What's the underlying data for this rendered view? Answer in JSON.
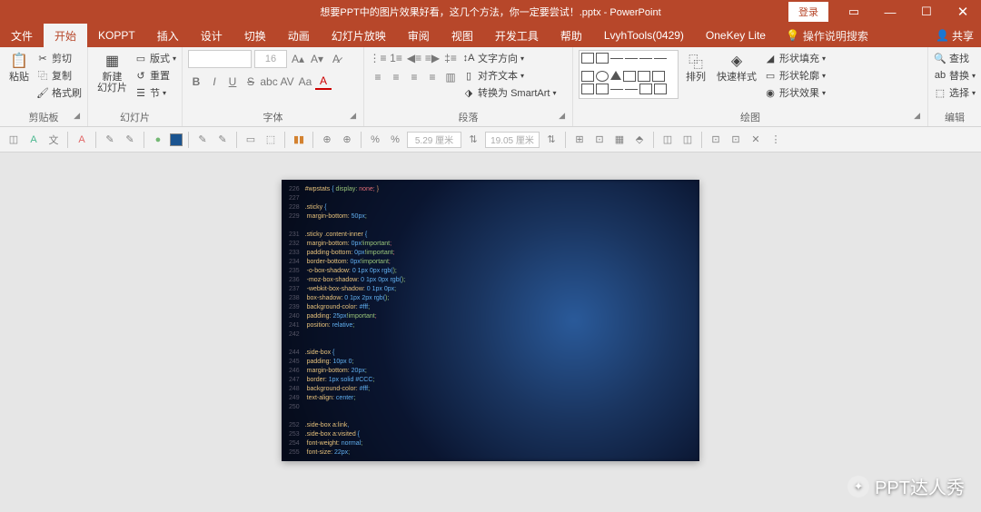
{
  "title": "想要PPT中的图片效果好看，这几个方法，你一定要尝试！.pptx - PowerPoint",
  "login": "登录",
  "menu": {
    "file": "文件",
    "home": "开始",
    "koppt": "KOPPT",
    "insert": "插入",
    "design": "设计",
    "transitions": "切换",
    "animations": "动画",
    "slideshow": "幻灯片放映",
    "review": "审阅",
    "view": "视图",
    "developer": "开发工具",
    "help": "帮助",
    "lvyh": "LvyhTools(0429)",
    "onekey": "OneKey Lite",
    "tellme": "操作说明搜索",
    "share": "共享"
  },
  "ribbon": {
    "clipboard": {
      "label": "剪贴板",
      "paste": "粘贴",
      "cut": "剪切",
      "copy": "复制",
      "painter": "格式刷"
    },
    "slides": {
      "label": "幻灯片",
      "new": "新建\n幻灯片",
      "layout": "版式",
      "reset": "重置",
      "section": "节"
    },
    "font": {
      "label": "字体",
      "size_placeholder": "16"
    },
    "paragraph": {
      "label": "段落",
      "direction": "文字方向",
      "align": "对齐文本",
      "smartart": "转换为 SmartArt"
    },
    "drawing": {
      "label": "绘图",
      "arrange": "排列",
      "quickstyles": "快速样式",
      "fill": "形状填充",
      "outline": "形状轮廓",
      "effects": "形状效果"
    },
    "editing": {
      "label": "编辑",
      "find": "查找",
      "replace": "替换",
      "select": "选择"
    }
  },
  "toolbar": {
    "dim1": "5.29 厘米",
    "dim2": "19.05 厘米"
  },
  "watermark": "PPT达人秀",
  "code": [
    {
      "n": "226",
      "t": [
        "#wpstats",
        " { ",
        "display:",
        " none;",
        " }"
      ]
    },
    {
      "n": "227",
      "t": [
        ""
      ]
    },
    {
      "n": "228",
      "t": [
        ".sticky",
        " {"
      ]
    },
    {
      "n": "229",
      "t": [
        "  margin-bottom:",
        " 50px",
        ";"
      ]
    },
    {
      "n": "",
      "t": [
        ""
      ]
    },
    {
      "n": "231",
      "t": [
        ".sticky .content-inner",
        " {"
      ]
    },
    {
      "n": "232",
      "t": [
        "  margin-bottom:",
        " 0px",
        "!important",
        ";"
      ]
    },
    {
      "n": "233",
      "t": [
        "  padding-bottom:",
        " 0px",
        "!important",
        ";"
      ]
    },
    {
      "n": "234",
      "t": [
        "  border-bottom:",
        " 0px",
        "!important",
        ";"
      ]
    },
    {
      "n": "235",
      "t": [
        "  -o-box-shadow:",
        " 0 1px 0px rgb(",
        ");"
      ]
    },
    {
      "n": "236",
      "t": [
        "  -moz-box-shadow:",
        " 0 1px 0px rgb(",
        ");"
      ]
    },
    {
      "n": "237",
      "t": [
        "  -webkit-box-shadow:",
        " 0 1px 0px",
        ";"
      ]
    },
    {
      "n": "238",
      "t": [
        "  box-shadow:",
        " 0 1px 2px rgb(",
        ");"
      ]
    },
    {
      "n": "239",
      "t": [
        "  background-color:",
        " #fff",
        ";"
      ]
    },
    {
      "n": "240",
      "t": [
        "  padding:",
        " 25px",
        "!important",
        ";"
      ]
    },
    {
      "n": "241",
      "t": [
        "  position:",
        " relative",
        ";"
      ]
    },
    {
      "n": "242",
      "t": [
        ""
      ]
    },
    {
      "n": "",
      "t": [
        ""
      ]
    },
    {
      "n": "244",
      "t": [
        ".side-box",
        " {"
      ]
    },
    {
      "n": "245",
      "t": [
        "  padding:",
        " 10px 0",
        ";"
      ]
    },
    {
      "n": "246",
      "t": [
        "  margin-bottom:",
        " 20px",
        ";"
      ]
    },
    {
      "n": "247",
      "t": [
        "  border:",
        " 1px solid #CCC",
        ";"
      ]
    },
    {
      "n": "248",
      "t": [
        "  background-color:",
        " #fff",
        ";"
      ]
    },
    {
      "n": "249",
      "t": [
        "  text-align:",
        " center",
        ";"
      ]
    },
    {
      "n": "250",
      "t": [
        ""
      ]
    },
    {
      "n": "",
      "t": [
        ""
      ]
    },
    {
      "n": "252",
      "t": [
        ".side-box a:link",
        ","
      ]
    },
    {
      "n": "253",
      "t": [
        ".side-box a:visited",
        " {"
      ]
    },
    {
      "n": "254",
      "t": [
        "  font-weight:",
        " normal",
        ";"
      ]
    },
    {
      "n": "255",
      "t": [
        "  font-size:",
        " 22px",
        ";"
      ]
    }
  ]
}
